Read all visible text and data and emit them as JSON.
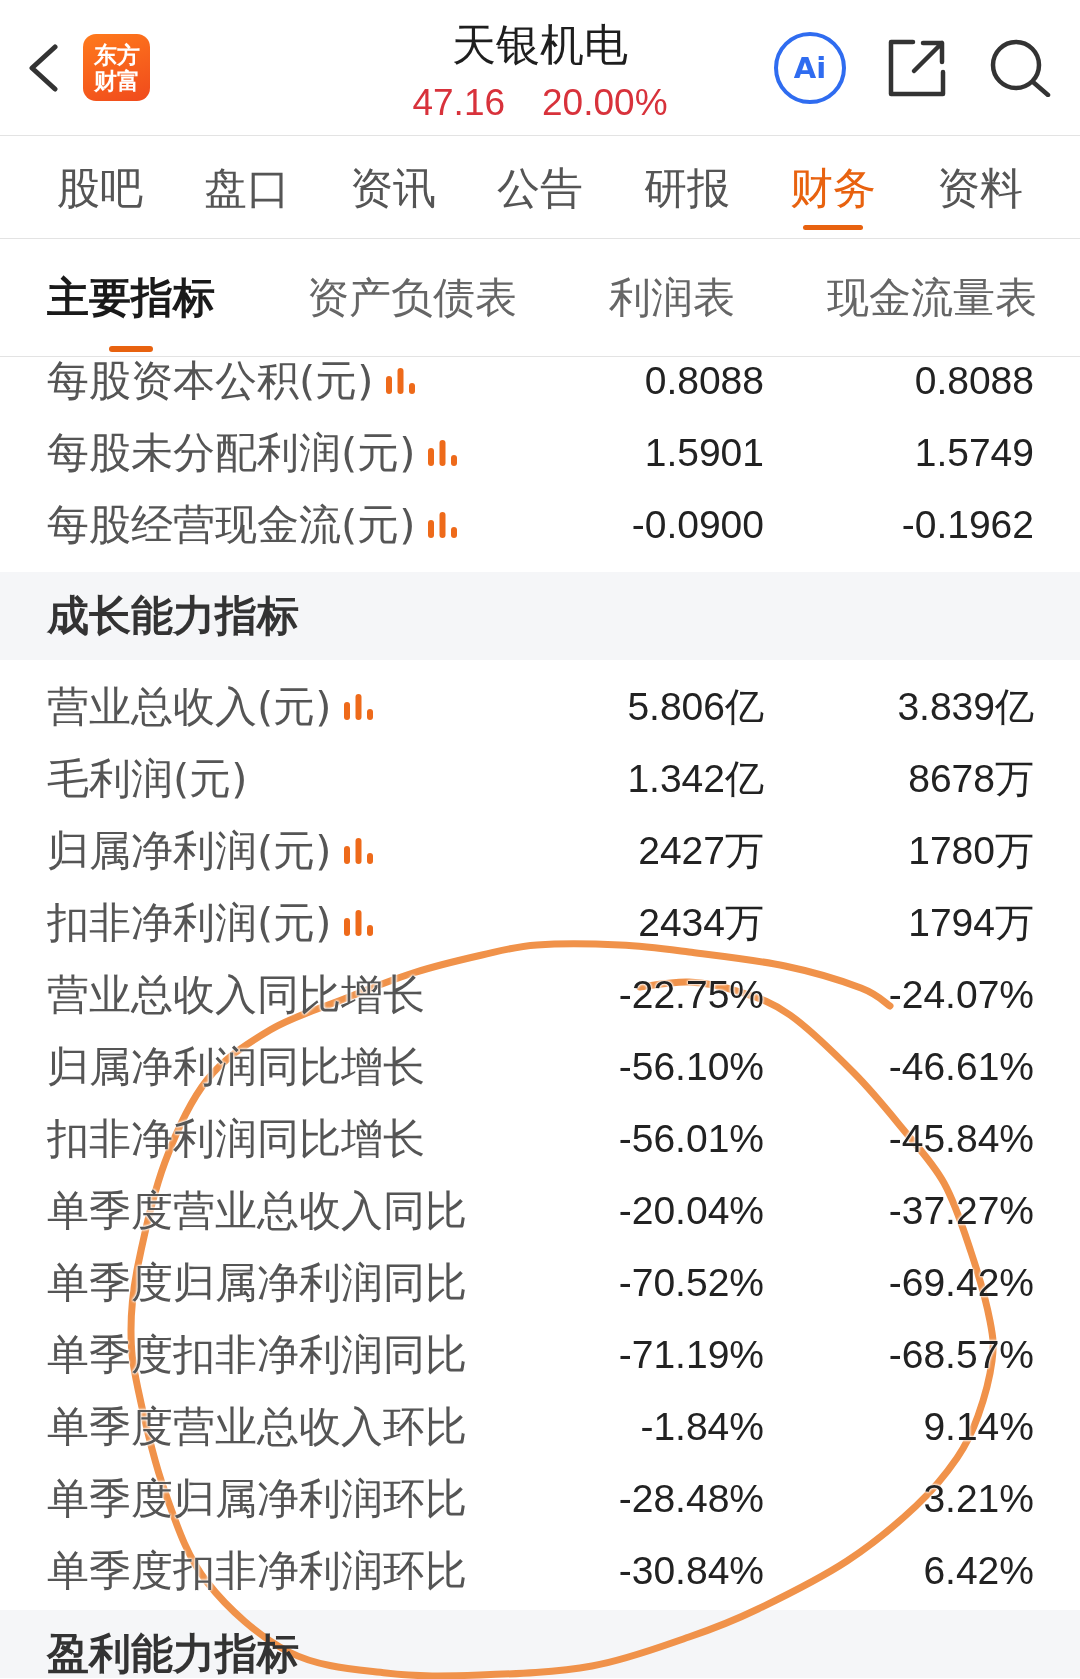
{
  "header": {
    "logo": {
      "lines": [
        "东方",
        "财富"
      ]
    },
    "title": "天银机电",
    "price": "47.16",
    "change": "20.00%",
    "ai_button": {
      "label": "Ai"
    }
  },
  "tabs": [
    {
      "label": "股吧",
      "selected": false
    },
    {
      "label": "盘口",
      "selected": false
    },
    {
      "label": "资讯",
      "selected": false
    },
    {
      "label": "公告",
      "selected": false
    },
    {
      "label": "研报",
      "selected": false
    },
    {
      "label": "财务",
      "selected": true
    },
    {
      "label": "资料",
      "selected": false
    }
  ],
  "sub_tabs": [
    {
      "label": "主要指标",
      "selected": true
    },
    {
      "label": "资产负债表",
      "selected": false
    },
    {
      "label": "利润表",
      "selected": false
    },
    {
      "label": "现金流量表",
      "selected": false
    }
  ],
  "sections": [
    {
      "rows": [
        {
          "label": "每股资本公积(元)",
          "chart_icon": true,
          "values": [
            "0.8088",
            "0.8088"
          ]
        },
        {
          "label": "每股未分配利润(元)",
          "chart_icon": true,
          "values": [
            "1.5901",
            "1.5749"
          ]
        },
        {
          "label": "每股经营现金流(元)",
          "chart_icon": true,
          "values": [
            "-0.0900",
            "-0.1962"
          ]
        }
      ]
    },
    {
      "title": "成长能力指标",
      "rows": [
        {
          "label": "营业总收入(元)",
          "chart_icon": true,
          "values": [
            "5.806亿",
            "3.839亿"
          ]
        },
        {
          "label": "毛利润(元)",
          "chart_icon": false,
          "values": [
            "1.342亿",
            "8678万"
          ]
        },
        {
          "label": "归属净利润(元)",
          "chart_icon": true,
          "values": [
            "2427万",
            "1780万"
          ]
        },
        {
          "label": "扣非净利润(元)",
          "chart_icon": true,
          "values": [
            "2434万",
            "1794万"
          ]
        },
        {
          "label": "营业总收入同比增长",
          "chart_icon": false,
          "values": [
            "-22.75%",
            "-24.07%"
          ]
        },
        {
          "label": "归属净利润同比增长",
          "chart_icon": false,
          "values": [
            "-56.10%",
            "-46.61%"
          ]
        },
        {
          "label": "扣非净利润同比增长",
          "chart_icon": false,
          "values": [
            "-56.01%",
            "-45.84%"
          ]
        },
        {
          "label": "单季度营业总收入同比",
          "chart_icon": false,
          "values": [
            "-20.04%",
            "-37.27%"
          ]
        },
        {
          "label": "单季度归属净利润同比",
          "chart_icon": false,
          "values": [
            "-70.52%",
            "-69.42%"
          ]
        },
        {
          "label": "单季度扣非净利润同比",
          "chart_icon": false,
          "values": [
            "-71.19%",
            "-68.57%"
          ]
        },
        {
          "label": "单季度营业总收入环比",
          "chart_icon": false,
          "values": [
            "-1.84%",
            "9.14%"
          ]
        },
        {
          "label": "单季度归属净利润环比",
          "chart_icon": false,
          "values": [
            "-28.48%",
            "3.21%"
          ]
        },
        {
          "label": "单季度扣非净利润环比",
          "chart_icon": false,
          "values": [
            "-30.84%",
            "6.42%"
          ]
        }
      ]
    },
    {
      "title": "盈利能力指标"
    }
  ]
}
